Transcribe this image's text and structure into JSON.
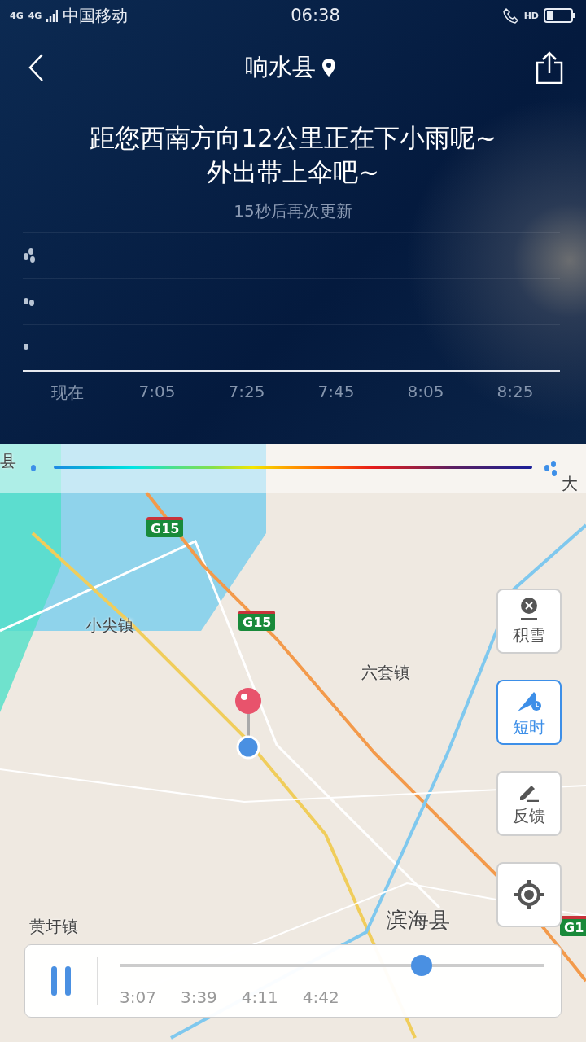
{
  "status_bar": {
    "network": "4G",
    "network2": "4G",
    "carrier": "中国移动",
    "time": "06:38",
    "call_badge": "HD"
  },
  "header": {
    "title": "响水县"
  },
  "forecast": {
    "message": "距您西南方向12公里正在下小雨呢~\n外出带上伞吧~",
    "update_note": "15秒后再次更新"
  },
  "time_axis": [
    "现在",
    "7:05",
    "7:25",
    "7:45",
    "8:05",
    "8:25"
  ],
  "map": {
    "labels": [
      {
        "text": "县",
        "kind": "town"
      },
      {
        "text": "大",
        "kind": "town"
      },
      {
        "text": "G15",
        "kind": "shield"
      },
      {
        "text": "小尖镇",
        "kind": "town"
      },
      {
        "text": "G15",
        "kind": "shield"
      },
      {
        "text": "六套镇",
        "kind": "town"
      },
      {
        "text": "黄圩镇",
        "kind": "town"
      },
      {
        "text": "滨海县",
        "kind": "county"
      },
      {
        "text": "G1",
        "kind": "shield"
      }
    ]
  },
  "map_controls": [
    {
      "label": "积雪",
      "kind": "snow",
      "selected": false
    },
    {
      "label": "短时",
      "kind": "umbrella",
      "selected": true
    },
    {
      "label": "反馈",
      "kind": "pencil",
      "selected": false
    },
    {
      "kind": "locate",
      "selected": false
    }
  ],
  "player": {
    "playing": true,
    "level": 0.71,
    "times": [
      "3:07",
      "3:39",
      "4:11",
      "4:42"
    ]
  }
}
